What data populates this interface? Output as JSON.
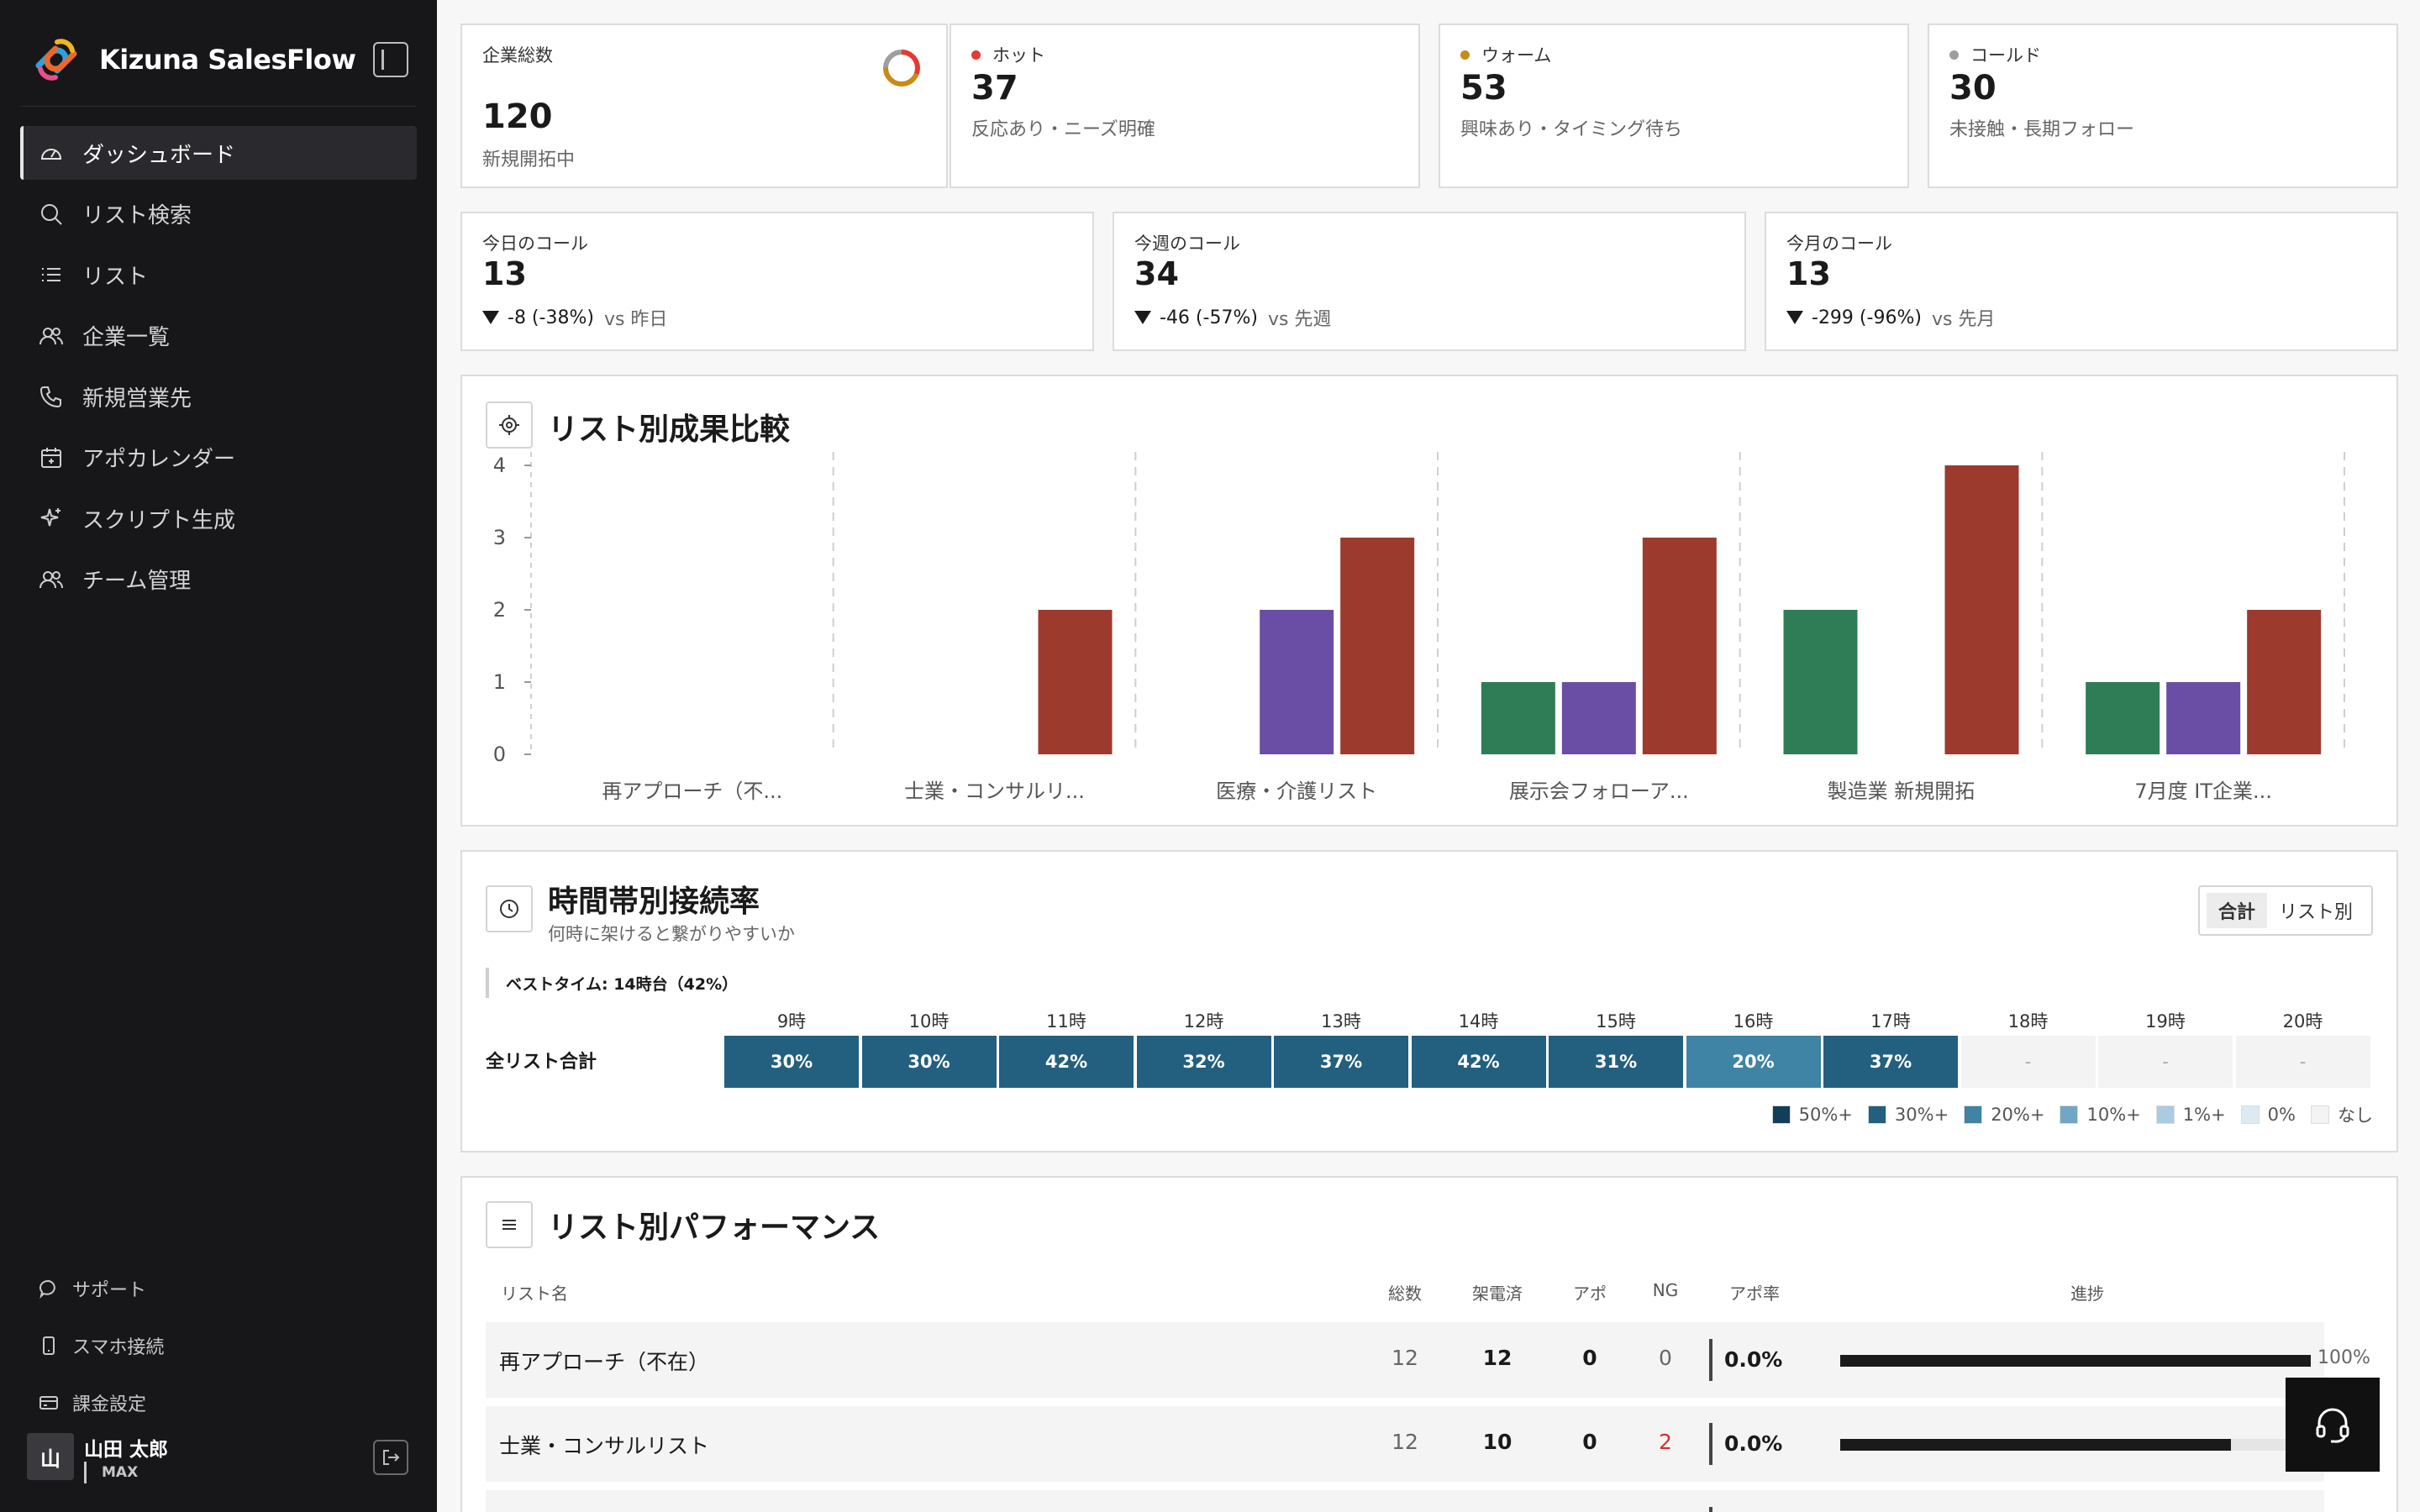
{
  "app": {
    "name": "Kizuna SalesFlow"
  },
  "sidebar": {
    "items": [
      {
        "label": "ダッシュボード",
        "icon": "gauge-icon"
      },
      {
        "label": "リスト検索",
        "icon": "search-icon"
      },
      {
        "label": "リスト",
        "icon": "list-icon"
      },
      {
        "label": "企業一覧",
        "icon": "users-icon"
      },
      {
        "label": "新規営業先",
        "icon": "phone-icon"
      },
      {
        "label": "アポカレンダー",
        "icon": "calendar-icon"
      },
      {
        "label": "スクリプト生成",
        "icon": "sparkle-icon"
      },
      {
        "label": "チーム管理",
        "icon": "team-icon"
      }
    ],
    "bottom": [
      {
        "label": "サポート",
        "icon": "chat-icon"
      },
      {
        "label": "スマホ接続",
        "icon": "smartphone-icon"
      },
      {
        "label": "課金設定",
        "icon": "billing-icon"
      }
    ],
    "user": {
      "avatar": "山",
      "name": "山田 太郎",
      "plan": "MAX"
    }
  },
  "stats": [
    {
      "label": "企業総数",
      "value": "120",
      "sub": "新規開拓中"
    },
    {
      "label": "ホット",
      "value": "37",
      "sub": "反応あり・ニーズ明確",
      "dot": "#e53935"
    },
    {
      "label": "ウォーム",
      "value": "53",
      "sub": "興味あり・タイミング待ち",
      "dot": "#c98a16"
    },
    {
      "label": "コールド",
      "value": "30",
      "sub": "未接触・長期フォロー",
      "dot": "#9e9e9e"
    }
  ],
  "calls": [
    {
      "label": "今日のコール",
      "value": "13",
      "delta": "-8 (-38%)",
      "vs": "vs 昨日"
    },
    {
      "label": "今週のコール",
      "value": "34",
      "delta": "-46 (-57%)",
      "vs": "vs 先週"
    },
    {
      "label": "今月のコール",
      "value": "13",
      "delta": "-299 (-96%)",
      "vs": "vs 先月"
    }
  ],
  "list_chart": {
    "title": "リスト別成果比較",
    "chart_data": {
      "type": "bar",
      "categories": [
        "再アプローチ（不...",
        "士業・コンサルリ...",
        "医療・介護リスト",
        "展示会フォローア...",
        "製造業 新規開拓",
        "7月度 IT企業..."
      ],
      "series": [
        {
          "values": [
            0,
            0,
            0,
            1,
            2,
            1
          ],
          "color": "#2e7d57"
        },
        {
          "values": [
            0,
            0,
            2,
            1,
            0,
            1
          ],
          "color": "#6a4ea6"
        },
        {
          "values": [
            0,
            2,
            3,
            3,
            4,
            2
          ],
          "color": "#9c3a2e"
        }
      ],
      "ylim": [
        0,
        4
      ],
      "yticks": [
        "0",
        "1",
        "2",
        "3",
        "4"
      ]
    }
  },
  "hourly": {
    "title": "時間帯別接続率",
    "subtitle": "何時に架けると繋がりやすいか",
    "toggle": [
      "合計",
      "リスト別"
    ],
    "best_time": "ベストタイム: 14時台（42%）",
    "row_label": "全リスト合計",
    "hours": [
      "9時",
      "10時",
      "11時",
      "12時",
      "13時",
      "14時",
      "15時",
      "16時",
      "17時",
      "18時",
      "19時",
      "20時"
    ],
    "values": [
      "30%",
      "30%",
      "42%",
      "32%",
      "37%",
      "42%",
      "31%",
      "20%",
      "37%",
      "-",
      "-",
      "-"
    ],
    "cell_colors": [
      "#235f7f",
      "#235f7f",
      "#235f7f",
      "#235f7f",
      "#235f7f",
      "#235f7f",
      "#235f7f",
      "#3f83a5",
      "#235f7f",
      null,
      null,
      null
    ],
    "legend": [
      {
        "label": "50%+",
        "color": "#123e59"
      },
      {
        "label": "30%+",
        "color": "#235f7f"
      },
      {
        "label": "20%+",
        "color": "#3f83a5"
      },
      {
        "label": "10%+",
        "color": "#6fa7c5"
      },
      {
        "label": "1%+",
        "color": "#a9cce0"
      },
      {
        "label": "0%",
        "color": "#dbeaf3"
      },
      {
        "label": "なし",
        "color": "#f3f3f3"
      }
    ]
  },
  "performance": {
    "title": "リスト別パフォーマンス",
    "headers": {
      "name": "リスト名",
      "total": "総数",
      "called": "架電済",
      "apo": "アポ",
      "ng": "NG",
      "rate": "アポ率",
      "progress": "進捗"
    },
    "rows": [
      {
        "name": "再アプローチ（不在）",
        "total": "12",
        "called": "12",
        "apo": "0",
        "ng": "0",
        "rate": "0.0%",
        "progress": 1.0,
        "progress_label": "100%"
      },
      {
        "name": "士業・コンサルリスト",
        "total": "12",
        "called": "10",
        "apo": "0",
        "ng": "2",
        "rate": "0.0%",
        "progress": 0.83,
        "progress_label": ""
      }
    ]
  }
}
